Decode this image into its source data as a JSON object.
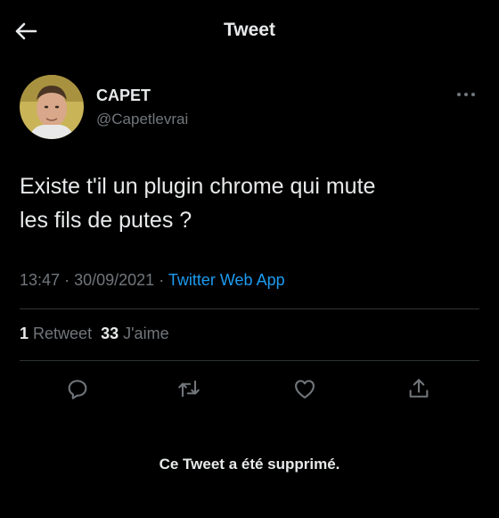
{
  "header": {
    "title": "Tweet",
    "back_icon": "arrow-left-icon"
  },
  "author": {
    "name": "CAPET",
    "handle": "@Capetlevrai",
    "more_icon": "more-horizontal-icon"
  },
  "tweet": {
    "text_line1": "Existe t'il un plugin chrome qui mute",
    "text_line2": "les fils de putes ?",
    "time": "13:47",
    "date": "30/09/2021",
    "separator": "·",
    "source": "Twitter Web App"
  },
  "stats": {
    "retweets_count": "1",
    "retweets_label": "Retweet",
    "likes_count": "33",
    "likes_label": "J'aime"
  },
  "actions": {
    "reply_icon": "reply-icon",
    "retweet_icon": "retweet-icon",
    "like_icon": "heart-icon",
    "share_icon": "share-icon"
  },
  "notice": {
    "deleted": "Ce Tweet a été supprimé."
  },
  "colors": {
    "background": "#000000",
    "text": "#e7e9ea",
    "secondary": "#71767b",
    "link": "#1d9bf0",
    "divider": "#2f3336"
  }
}
